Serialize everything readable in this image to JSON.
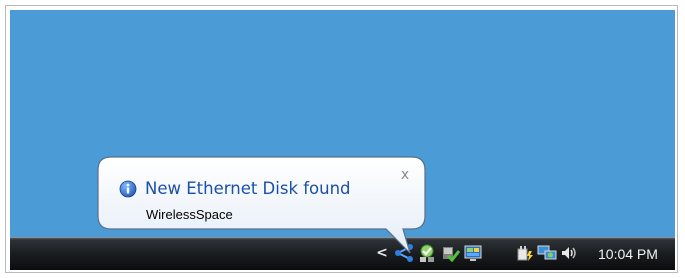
{
  "balloon": {
    "title": "New Ethernet Disk found",
    "body": "WirelessSpace",
    "close_label": "x",
    "icon": "info-icon"
  },
  "taskbar": {
    "chevron_label": "<",
    "tray_icons": [
      {
        "name": "network-share-icon"
      },
      {
        "name": "security-center-icon"
      },
      {
        "name": "update-checkmark-icon"
      },
      {
        "name": "display-monitor-icon"
      },
      {
        "name": "power-plug-icon"
      },
      {
        "name": "network-connection-icon"
      },
      {
        "name": "speaker-volume-icon"
      }
    ],
    "clock": "10:04 PM"
  },
  "colors": {
    "desktop": "#4b9bd6",
    "balloon_title": "#1b50a8",
    "taskbar": "#1b1e21"
  }
}
